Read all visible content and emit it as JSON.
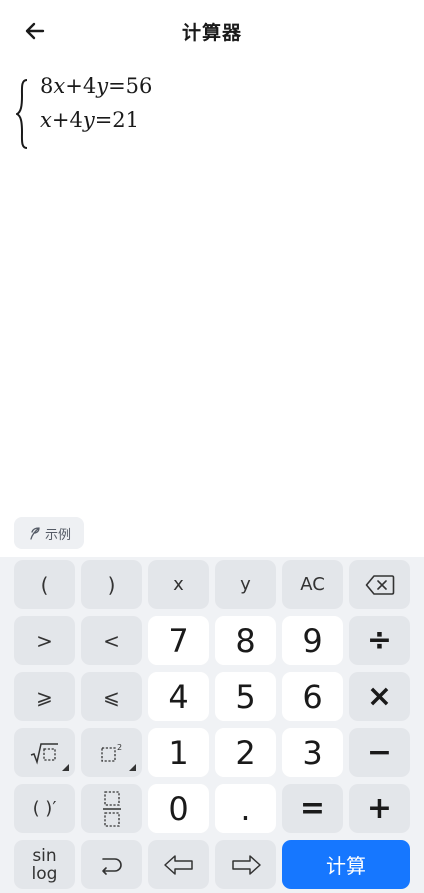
{
  "header": {
    "title": "计算器",
    "back_icon": "arrow-left-icon"
  },
  "equations": {
    "line1": [
      {
        "t": "8",
        "i": false
      },
      {
        "t": "x",
        "i": true
      },
      {
        "t": "+4",
        "i": false
      },
      {
        "t": "y",
        "i": true
      },
      {
        "t": "=56",
        "i": false
      }
    ],
    "line2": [
      {
        "t": "x",
        "i": true
      },
      {
        "t": "+4",
        "i": false
      },
      {
        "t": "y",
        "i": true
      },
      {
        "t": "=21",
        "i": false
      }
    ]
  },
  "example": {
    "label": "示例",
    "icon": "sprout-icon"
  },
  "keys": {
    "lparen": "(",
    "rparen": ")",
    "x": "x",
    "y": "y",
    "ac": "AC",
    "gt": ">",
    "lt": "<",
    "n7": "7",
    "n8": "8",
    "n9": "9",
    "div": "÷",
    "ge": "⩾",
    "le": "⩽",
    "n4": "4",
    "n5": "5",
    "n6": "6",
    "mul": "×",
    "n1": "1",
    "n2": "2",
    "n3": "3",
    "minus": "−",
    "deriv": "( )′",
    "n0": "0",
    "dot": ".",
    "eq": "=",
    "plus": "+",
    "sin": "sin",
    "log": "log",
    "calc": "计算"
  },
  "colors": {
    "accent": "#1677ff",
    "keypad_bg": "#f0f2f5",
    "key_gray": "#e3e6ea"
  }
}
